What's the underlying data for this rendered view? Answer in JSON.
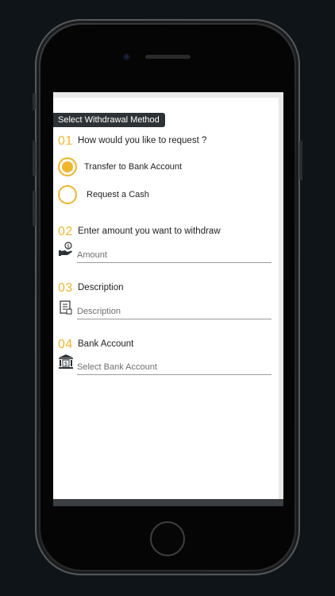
{
  "header": {
    "title": "Select Withdrawal Method"
  },
  "step1": {
    "number": "01",
    "label": "How would you like to request ?",
    "options": [
      {
        "label": "Transfer to Bank Account",
        "selected": true
      },
      {
        "label": "Request a Cash",
        "selected": false
      }
    ]
  },
  "step2": {
    "number": "02",
    "label": "Enter amount you want to withdraw",
    "placeholder": "Amount",
    "icon": "money-hand-icon"
  },
  "step3": {
    "number": "03",
    "label": "Description",
    "placeholder": "Description",
    "icon": "receipt-icon"
  },
  "step4": {
    "number": "04",
    "label": "Bank Account",
    "placeholder": "Select Bank Account",
    "icon": "bank-icon"
  },
  "colors": {
    "accent": "#f2b52a",
    "header_bg": "#2d3236",
    "text": "#222222"
  }
}
